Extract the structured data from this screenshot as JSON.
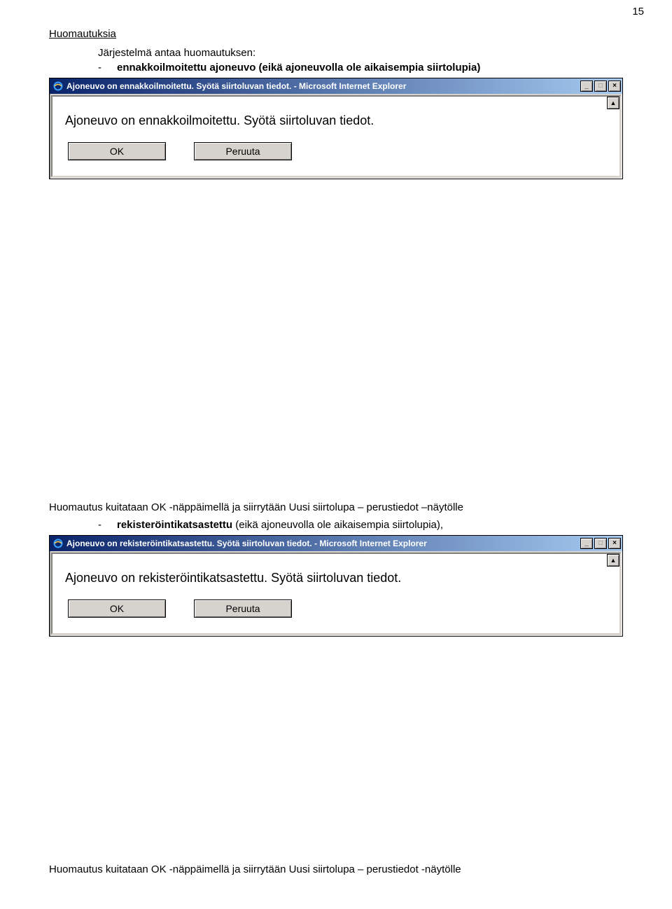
{
  "page_number": "15",
  "section_title": "Huomautuksia",
  "intro_text": "Järjestelmä antaa huomautuksen:",
  "bullet1": "ennakkoilmoitettu ajoneuvo (eikä ajoneuvolla ole aikaisempia siirtolupia)",
  "dialog1": {
    "title": "Ajoneuvo on ennakkoilmoitettu. Syötä siirtoluvan tiedot. - Microsoft Internet Explorer",
    "message": "Ajoneuvo on ennakkoilmoitettu. Syötä siirtoluvan tiedot.",
    "ok_label": "OK",
    "cancel_label": "Peruuta",
    "min_glyph": "_",
    "max_glyph": "□",
    "close_glyph": "×",
    "scroll_glyph": "▲"
  },
  "caption1": "Huomautus kuitataan OK -näppäimellä ja siirrytään  Uusi siirtolupa – perustiedot –näytölle",
  "bullet2_prefix": "rekisteröintikatsastettu",
  "bullet2_rest": " (eikä ajoneuvolla ole aikaisempia siirtolupia),",
  "dialog2": {
    "title": "Ajoneuvo on rekisteröintikatsastettu. Syötä siirtoluvan tiedot. - Microsoft Internet Explorer",
    "message": "Ajoneuvo on rekisteröintikatsastettu. Syötä siirtoluvan tiedot.",
    "ok_label": "OK",
    "cancel_label": "Peruuta",
    "min_glyph": "_",
    "max_glyph": "□",
    "close_glyph": "×",
    "scroll_glyph": "▲"
  },
  "caption2": "Huomautus kuitataan OK -näppäimellä ja siirrytään  Uusi siirtolupa – perustiedot -näytölle"
}
